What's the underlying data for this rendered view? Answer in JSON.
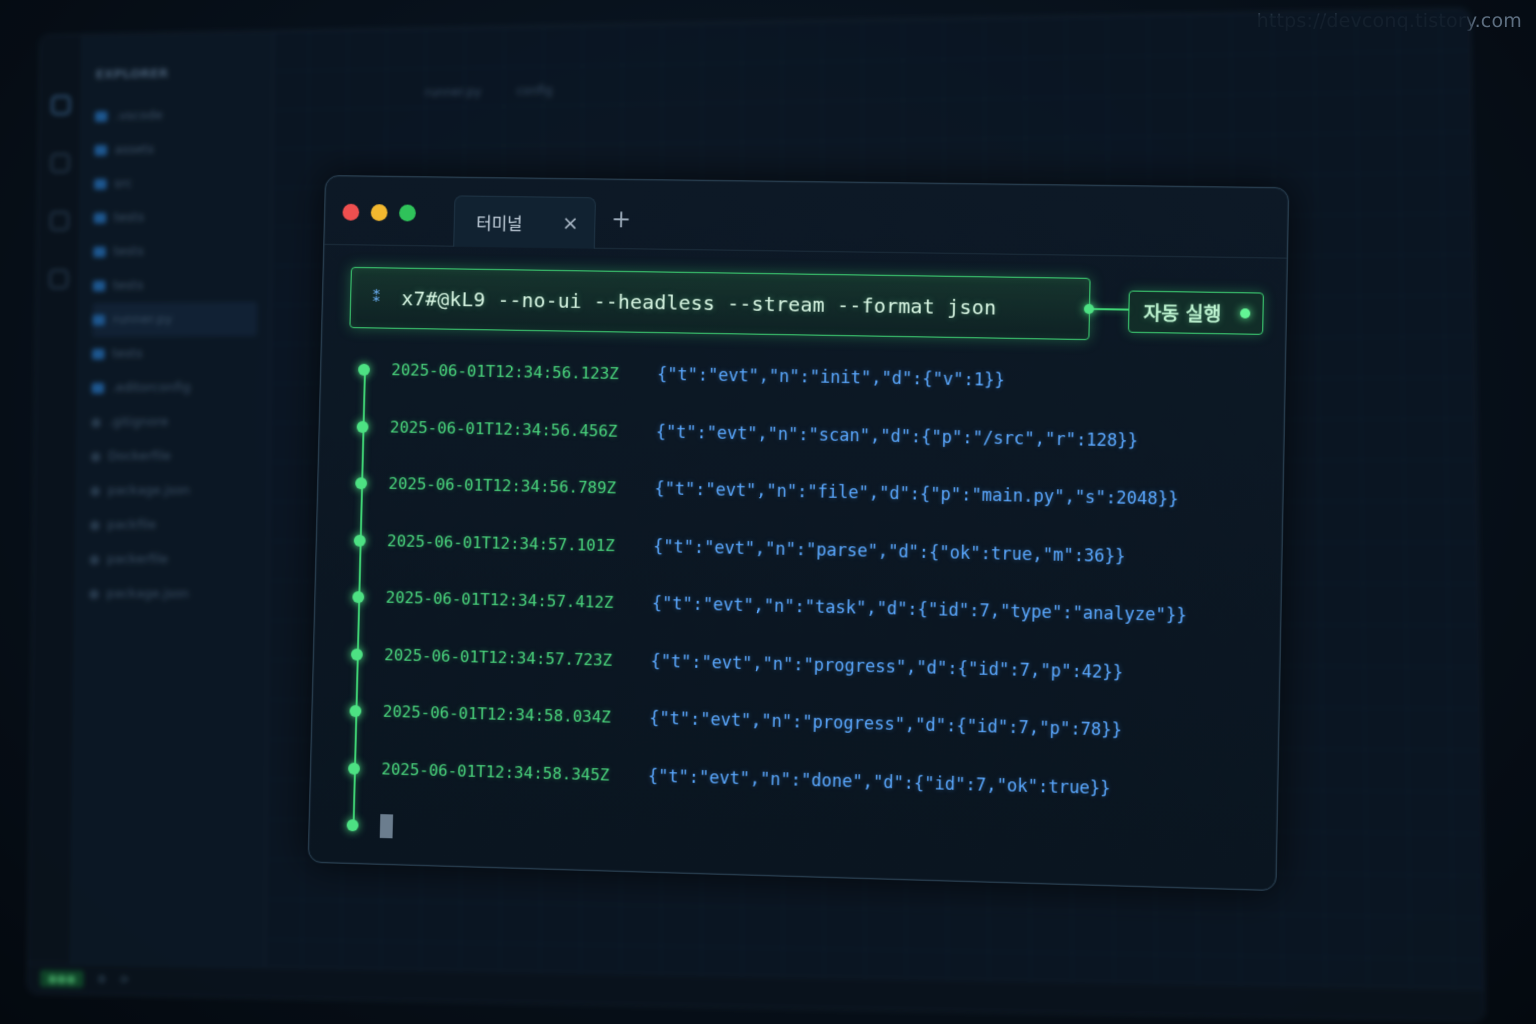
{
  "watermark": "https://devconq.tistory.com",
  "ide": {
    "explorer_title": "EXPLORER",
    "tree": [
      ".vscode",
      "assets",
      "src",
      "tests",
      "tests",
      "tests",
      "runner.py",
      "tests",
      ".editorconfig",
      ".gitignore",
      "Dockerfile",
      "package.json",
      "packfile",
      "packerfile",
      "package.json"
    ],
    "tabs": [
      "runner.py",
      "config"
    ]
  },
  "terminal": {
    "tab_label": "터미널",
    "tab_close": "×",
    "tab_add": "+",
    "command": {
      "icon": "⁑",
      "text": "x7#@kL9 --no-ui --headless --stream --format json"
    },
    "auto_badge": "자동 실행",
    "logs": [
      {
        "ts": "2025-06-01T12:34:56.123Z",
        "json": "{\"t\":\"evt\",\"n\":\"init\",\"d\":{\"v\":1}}"
      },
      {
        "ts": "2025-06-01T12:34:56.456Z",
        "json": "{\"t\":\"evt\",\"n\":\"scan\",\"d\":{\"p\":\"/src\",\"r\":128}}"
      },
      {
        "ts": "2025-06-01T12:34:56.789Z",
        "json": "{\"t\":\"evt\",\"n\":\"file\",\"d\":{\"p\":\"main.py\",\"s\":2048}}"
      },
      {
        "ts": "2025-06-01T12:34:57.101Z",
        "json": "{\"t\":\"evt\",\"n\":\"parse\",\"d\":{\"ok\":true,\"m\":36}}"
      },
      {
        "ts": "2025-06-01T12:34:57.412Z",
        "json": "{\"t\":\"evt\",\"n\":\"task\",\"d\":{\"id\":7,\"type\":\"analyze\"}}"
      },
      {
        "ts": "2025-06-01T12:34:57.723Z",
        "json": "{\"t\":\"evt\",\"n\":\"progress\",\"d\":{\"id\":7,\"p\":42}}"
      },
      {
        "ts": "2025-06-01T12:34:58.034Z",
        "json": "{\"t\":\"evt\",\"n\":\"progress\",\"d\":{\"id\":7,\"p\":78}}"
      },
      {
        "ts": "2025-06-01T12:34:58.345Z",
        "json": "{\"t\":\"evt\",\"n\":\"done\",\"d\":{\"id\":7,\"ok\":true}}"
      }
    ]
  },
  "colors": {
    "accent_green": "#3fd475",
    "timestamp_green": "#49d37c",
    "json_blue": "#5aa8ff",
    "close_red": "#ee4f4f",
    "minimize_yellow": "#f2b82f",
    "maximize_green": "#2fc25a"
  }
}
